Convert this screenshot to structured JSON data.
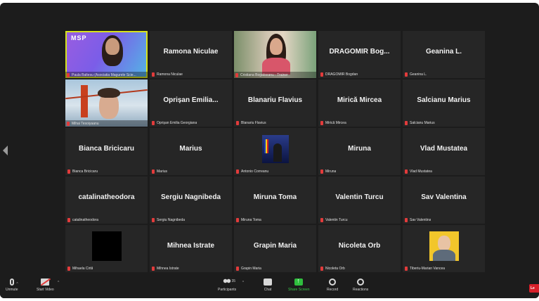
{
  "tiles": [
    {
      "big": "",
      "label": "Paula Baltesu (Asociatia Magurele Scie...",
      "video": "msp",
      "logo": "MSP",
      "active": true
    },
    {
      "big": "Ramona Niculae",
      "label": "Ramona Niculae"
    },
    {
      "big": "",
      "label": "Cristiana Bogatseanu - Trainer",
      "video": "woman"
    },
    {
      "big": "DRAGOMIR Bog...",
      "label": "DRAGOMIR Bogdan"
    },
    {
      "big": "Geanina L.",
      "label": "Geanina L."
    },
    {
      "big": "",
      "label": "Mihai Tesoiyaanu",
      "video": "bridge"
    },
    {
      "big": "Oprișan Emilia...",
      "label": "Oprişan Emilia Georgiana"
    },
    {
      "big": "Blanariu Flavius",
      "label": "Blanariu Flavius"
    },
    {
      "big": "Mirică Mircea",
      "label": "Mirică Mircea"
    },
    {
      "big": "Salcianu Marius",
      "label": "Salcianu Marius"
    },
    {
      "big": "Bianca Bricicaru",
      "label": "Bianca Bricicaru"
    },
    {
      "big": "Marius",
      "label": "Marius"
    },
    {
      "big": "",
      "label": "Antonio Correanu",
      "video": "antonio"
    },
    {
      "big": "Miruna",
      "label": "Miruna"
    },
    {
      "big": "Vlad Mustatea",
      "label": "Vlad Mustatea"
    },
    {
      "big": "catalinatheodora",
      "label": "catalinatheodora"
    },
    {
      "big": "Sergiu Nagnibeda",
      "label": "Sergiu Nagnibeda"
    },
    {
      "big": "Miruna Toma",
      "label": "Miruna Toma"
    },
    {
      "big": "Valentin Turcu",
      "label": "Valentin Turcu"
    },
    {
      "big": "Sav Valentina",
      "label": "Sav Valentina"
    },
    {
      "big": "",
      "label": "Mihaela Cirtă",
      "video": "black"
    },
    {
      "big": "Mihnea Istrate",
      "label": "Mihnea Istrate"
    },
    {
      "big": "Grapin Maria",
      "label": "Grapin Maria"
    },
    {
      "big": "Nicoleta Orb",
      "label": "Nicoleta Orb"
    },
    {
      "big": "",
      "label": "Tiberiu-Marian Vancea",
      "video": "avatar"
    }
  ],
  "toolbar": {
    "mute": "Unmute",
    "video": "Start Video",
    "participants": "Participants",
    "participants_count": "35",
    "chat": "Chat",
    "share": "Share Screen",
    "record": "Record",
    "reactions": "Reactions",
    "leave": "Le"
  },
  "colors": {
    "background": "#1c1c1c",
    "tile": "#262626",
    "active_speaker": "#d6e21c",
    "share_green": "#2fbf3e",
    "leave_red": "#d8202a"
  }
}
